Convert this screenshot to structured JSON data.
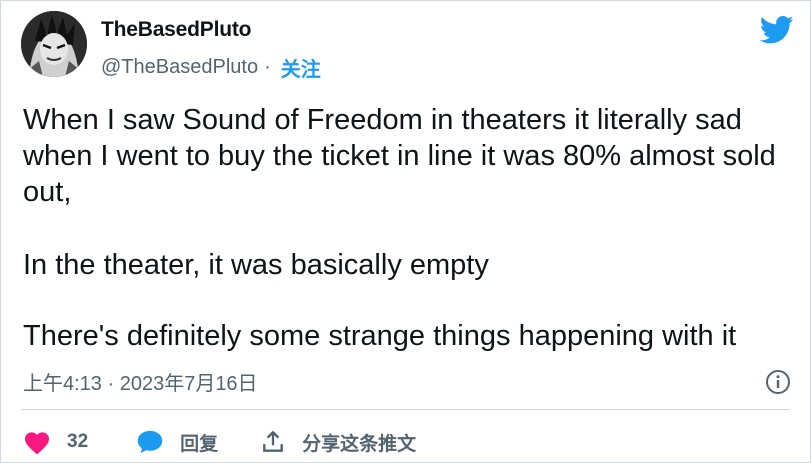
{
  "author": {
    "display_name": "TheBasedPluto",
    "handle": "@TheBasedPluto",
    "separator": "·",
    "follow_label": "关注"
  },
  "tweet": {
    "paragraphs": [
      "When I saw Sound of Freedom in theaters it literally sad when I went to buy the ticket in line it was 80% almost sold out,",
      "In the theater, it was basically empty",
      "There's definitely some strange things happening with it"
    ],
    "timestamp": "上午4:13 · 2023年7月16日"
  },
  "actions": {
    "like_count": "32",
    "reply_label": "回复",
    "share_label": "分享这条推文"
  },
  "icons": {
    "logo": "twitter-bird-icon",
    "info": "info-icon",
    "like": "heart-icon",
    "reply": "speech-bubble-icon",
    "share": "share-upload-icon"
  },
  "colors": {
    "brand": "#1d9bf0",
    "like": "#f91880",
    "text": "#0f1419",
    "muted": "#536471",
    "border": "#cfd9de"
  }
}
